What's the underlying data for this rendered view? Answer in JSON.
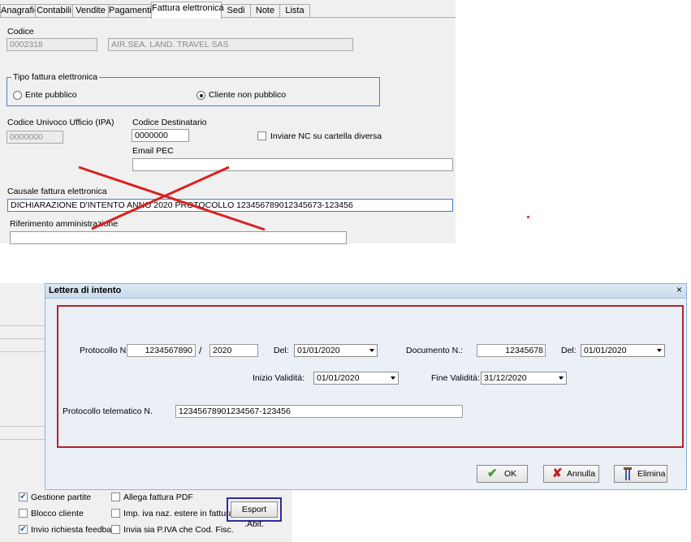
{
  "tabs": [
    "Anagrafici",
    "Contabili",
    "Vendite",
    "Pagamenti",
    "Fattura elettronica",
    "Sedi",
    "Note",
    "Lista"
  ],
  "customer": {
    "codice_label": "Codice",
    "codice_value": "0002318",
    "name_value": "AIR.SEA. LAND. TRAVEL SAS"
  },
  "tipo_fattura": {
    "legend": "Tipo fattura elettronica",
    "option_public": "Ente pubblico",
    "option_private": "Cliente non pubblico",
    "selected": "Cliente non pubblico"
  },
  "ipa": {
    "label": "Codice Univoco Ufficio (IPA)",
    "value": "0000000"
  },
  "destinatario": {
    "label": "Codice Destinatario",
    "value": "0000000"
  },
  "nc_checkbox": {
    "label": "Inviare NC su cartella diversa"
  },
  "pec": {
    "label": "Email PEC",
    "value": ""
  },
  "causale": {
    "label": "Causale fattura elettronica",
    "value": "DICHIARAZIONE D'INTENTO ANNO 2020 PROTOCOLLO 123456789012345673-123456"
  },
  "riferimento": {
    "label": "Riferimento amministrazione",
    "value": ""
  },
  "dialog": {
    "title": "Lettera di intento",
    "close_glyph": "×",
    "protocollo_label": "Protocollo N.",
    "protocollo_value": "1234567890",
    "slash": "/",
    "anno_value": "2020",
    "del_label": "Del:",
    "del_value": "01/01/2020",
    "documento_label": "Documento N.:",
    "documento_value": "12345678",
    "del2_label": "Del:",
    "del2_value": "01/01/2020",
    "inizio_label": "Inizio Validità:",
    "inizio_value": "01/01/2020",
    "fine_label": "Fine Validità:",
    "fine_value": "31/12/2020",
    "telematico_label": "Protocollo telematico N.",
    "telematico_value": "12345678901234567-123456",
    "ok_label": "OK",
    "annulla_label": "Annulla",
    "elimina_label": "Elimina"
  },
  "bottom": {
    "gestione_partite": "Gestione partite",
    "allega_pdf": "Allega fattura PDF",
    "blocco_cliente": "Blocco cliente",
    "imp_iva": "Imp. iva naz. estere in fattura",
    "esport_abit": "Esport .Abit.",
    "invio_feedback": "Invio richiesta feedback",
    "invia_piva": "Invia sia P.IVA che Cod. Fisc."
  },
  "colors": {
    "accent_blue": "#4a7fc8",
    "annotation_red": "#d92020",
    "highlight_box": "#b5222e",
    "export_border": "#2b2b9e"
  }
}
